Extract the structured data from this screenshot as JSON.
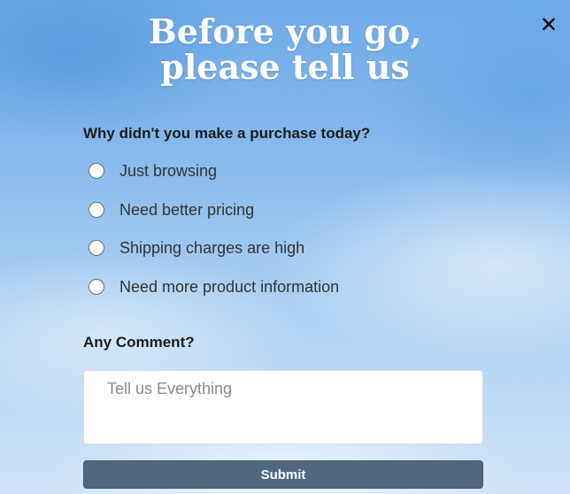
{
  "popup": {
    "title_line1": "Before you go,",
    "title_line2": "please tell us",
    "close_icon": "close-icon",
    "close_symbol": "✕"
  },
  "survey": {
    "question": "Why didn't you make a purchase today?",
    "options": [
      {
        "label": "Just browsing",
        "selected": false
      },
      {
        "label": "Need better pricing",
        "selected": false
      },
      {
        "label": "Shipping charges are high",
        "selected": false
      },
      {
        "label": "Need more product information",
        "selected": false
      }
    ]
  },
  "comment": {
    "label": "Any Comment?",
    "placeholder": "Tell us Everything",
    "value": ""
  },
  "submit": {
    "label": "Submit"
  },
  "colors": {
    "title_text": "#ffffff",
    "submit_bg": "#4f6880",
    "sky_top": "#6faae8",
    "sky_bottom": "#cfe3f8"
  }
}
